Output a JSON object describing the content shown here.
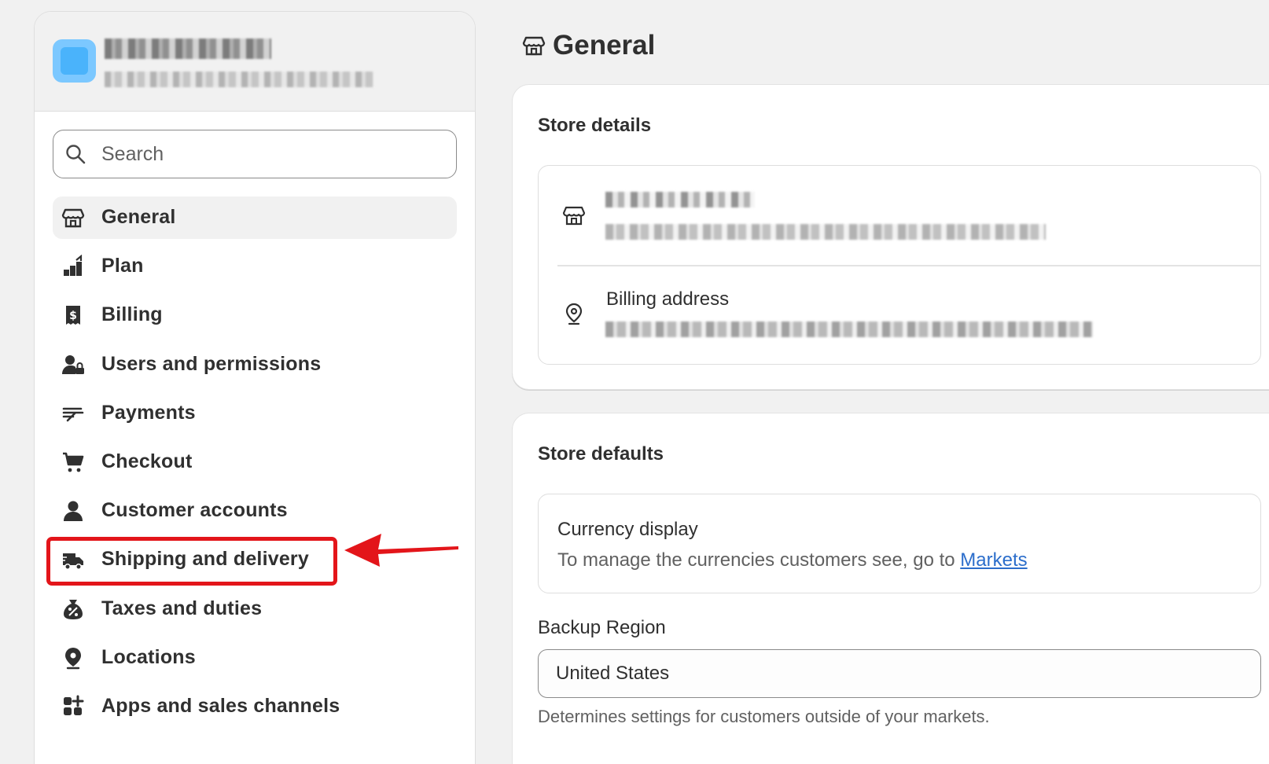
{
  "sidebar": {
    "search": {
      "placeholder": "Search"
    },
    "items": [
      {
        "label": "General",
        "icon": "store-icon",
        "active": true
      },
      {
        "label": "Plan",
        "icon": "plan-icon"
      },
      {
        "label": "Billing",
        "icon": "billing-icon"
      },
      {
        "label": "Users and permissions",
        "icon": "users-icon"
      },
      {
        "label": "Payments",
        "icon": "payments-icon"
      },
      {
        "label": "Checkout",
        "icon": "cart-icon"
      },
      {
        "label": "Customer accounts",
        "icon": "person-icon"
      },
      {
        "label": "Shipping and delivery",
        "icon": "truck-icon"
      },
      {
        "label": "Taxes and duties",
        "icon": "tax-icon"
      },
      {
        "label": "Locations",
        "icon": "location-icon"
      },
      {
        "label": "Apps and sales channels",
        "icon": "apps-icon"
      }
    ]
  },
  "annotation": {
    "highlight_color": "#e3151a",
    "target": "Shipping and delivery"
  },
  "main": {
    "title": "General",
    "store_details": {
      "title": "Store details",
      "billing_label": "Billing address"
    },
    "store_defaults": {
      "title": "Store defaults",
      "currency_title": "Currency display",
      "currency_text": "To manage the currencies customers see, go to ",
      "currency_link": "Markets",
      "backup_label": "Backup Region",
      "backup_value": "United States",
      "help_text": "Determines settings for customers outside of your markets."
    }
  },
  "colors": {
    "link": "#2c6ecb",
    "avatar": "#4ab3fb"
  }
}
